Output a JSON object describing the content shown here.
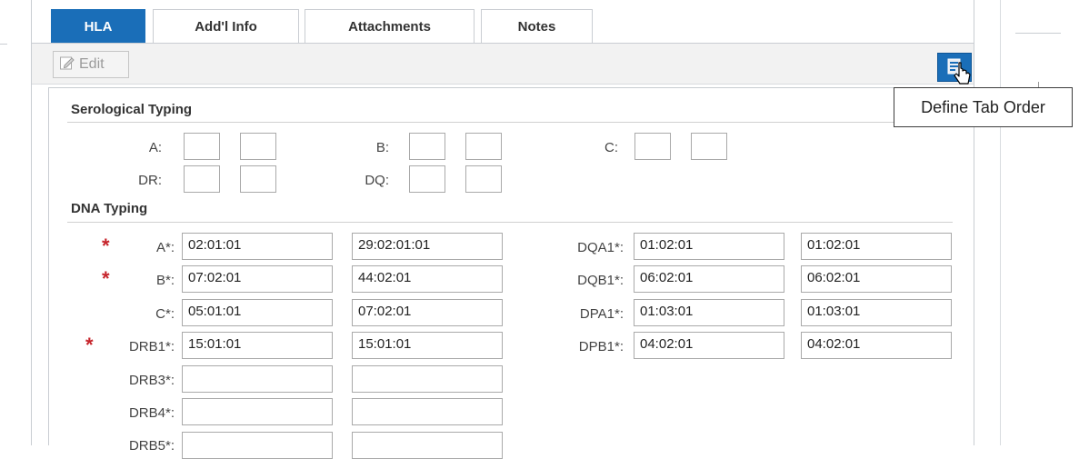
{
  "tabs": [
    {
      "label": "HLA",
      "active": true
    },
    {
      "label": "Add'l Info",
      "active": false
    },
    {
      "label": "Attachments",
      "active": false
    },
    {
      "label": "Notes",
      "active": false
    }
  ],
  "toolbar": {
    "edit_label": "Edit",
    "edit_icon": "pencil-edit-icon",
    "tab_order_icon": "tab-order-icon"
  },
  "tooltip": {
    "text": "Define Tab Order"
  },
  "serological": {
    "title": "Serological Typing",
    "labels": {
      "a": "A:",
      "b": "B:",
      "c": "C:",
      "dr": "DR:",
      "dq": "DQ:"
    }
  },
  "dna": {
    "title": "DNA Typing",
    "required_marker": "*",
    "rows_left": [
      {
        "label": "A*:",
        "required": true,
        "v1": "02:01:01",
        "v2": "29:02:01:01"
      },
      {
        "label": "B*:",
        "required": true,
        "v1": "07:02:01",
        "v2": "44:02:01"
      },
      {
        "label": "C*:",
        "required": false,
        "v1": "05:01:01",
        "v2": "07:02:01"
      },
      {
        "label": "DRB1*:",
        "required": true,
        "v1": "15:01:01",
        "v2": "15:01:01"
      },
      {
        "label": "DRB3*:",
        "required": false,
        "v1": "",
        "v2": ""
      },
      {
        "label": "DRB4*:",
        "required": false,
        "v1": "",
        "v2": ""
      },
      {
        "label": "DRB5*:",
        "required": false,
        "v1": "",
        "v2": ""
      }
    ],
    "rows_right": [
      {
        "label": "DQA1*:",
        "v1": "01:02:01",
        "v2": "01:02:01"
      },
      {
        "label": "DQB1*:",
        "v1": "06:02:01",
        "v2": "06:02:01"
      },
      {
        "label": "DPA1*:",
        "v1": "01:03:01",
        "v2": "01:03:01"
      },
      {
        "label": "DPB1*:",
        "v1": "04:02:01",
        "v2": "04:02:01"
      }
    ]
  },
  "colors": {
    "accent": "#1a6eb8",
    "required": "#c6242b"
  }
}
